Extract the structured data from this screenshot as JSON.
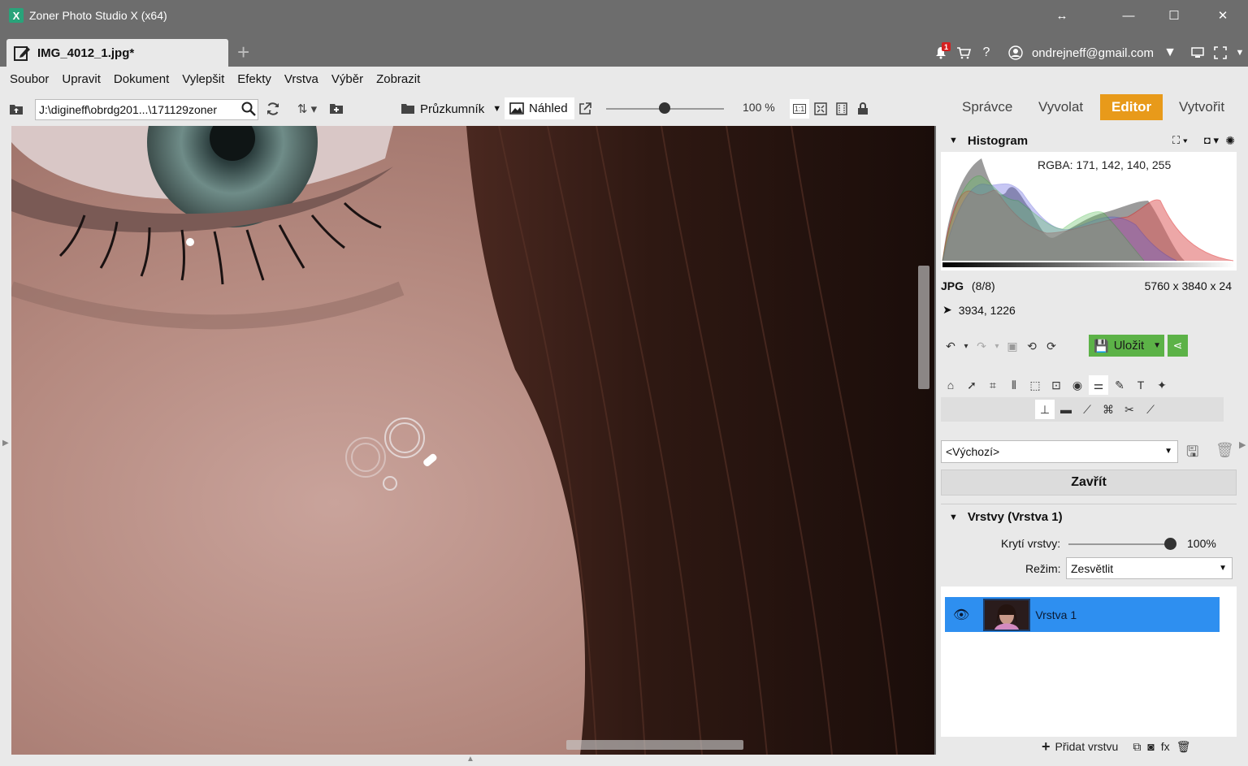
{
  "window": {
    "title": "Zoner Photo Studio X (x64)",
    "logo_glyph": "X",
    "buttons": {
      "resize": "↔",
      "minimize": "—",
      "maximize": "☐",
      "close": "✕"
    }
  },
  "tabs": {
    "document_tab": "IMG_4012_1.jpg*",
    "add_tab": "+"
  },
  "account": {
    "notification_count": "1",
    "email": "ondrejneff@gmail.com",
    "help": "?"
  },
  "menu": [
    "Soubor",
    "Upravit",
    "Dokument",
    "Vylepšit",
    "Efekty",
    "Vrstva",
    "Výběr",
    "Zobrazit"
  ],
  "toolbar": {
    "path_value": "J:\\digineff\\obrdg201...\\171129zoner",
    "explorer_label": "Průzkumník",
    "preview_label": "Náhled",
    "zoom_value": "100 %",
    "zoom_level": 0.5,
    "one_to_one": "1:1"
  },
  "modes": {
    "manager": "Správce",
    "develop": "Vyvolat",
    "editor": "Editor",
    "create": "Vytvořit"
  },
  "histogram": {
    "title": "Histogram",
    "rgba": "RGBA: 171, 142, 140, 255"
  },
  "image_info": {
    "format": "JPG",
    "index": "(8/8)",
    "dimensions": "5760 x 3840 x 24",
    "coordinates": "3934, 1226"
  },
  "actions": {
    "save_label": "Uložit"
  },
  "preset": {
    "value": "<Výchozí>",
    "close_label": "Zavřít"
  },
  "layers": {
    "title": "Vrstvy (Vrstva 1)",
    "opacity_label": "Krytí vrstvy:",
    "opacity_value": "100%",
    "blend_label": "Režim:",
    "blend_value": "Zesvětlit",
    "items": [
      {
        "name": "Vrstva 1"
      }
    ],
    "add_layer_label": "Přidat vrstvu",
    "fx_label": "fx"
  },
  "colors": {
    "editor_accent": "#e89a1a",
    "save_green": "#5cb247",
    "layer_selected": "#2e8ff0"
  }
}
